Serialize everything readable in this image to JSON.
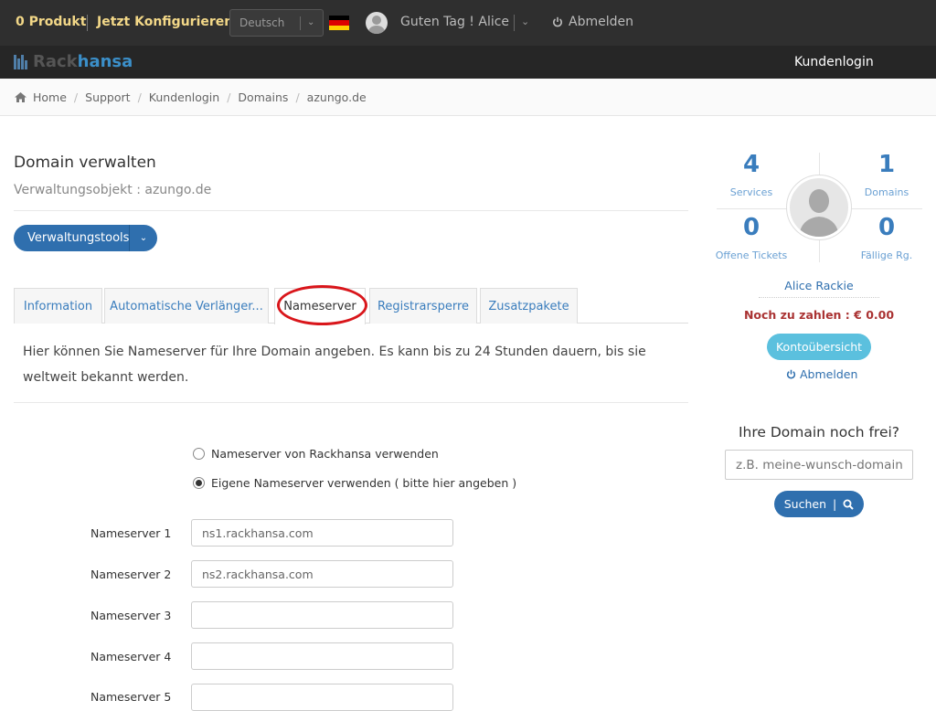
{
  "topbar": {
    "product_count": "0 Produkt",
    "configure": "Jetzt Konfigurieren",
    "language": "Deutsch",
    "greeting": "Guten Tag ! Alice",
    "logout": "Abmelden",
    "flag_colors": [
      "#000000",
      "#dd0000",
      "#ffce00"
    ]
  },
  "brand": {
    "part1": "Rack",
    "part2": "hansa",
    "accent": "#3b8fc9"
  },
  "nav": {
    "kundenlogin": "Kundenlogin"
  },
  "breadcrumb": [
    "Home",
    "Support",
    "Kundenlogin",
    "Domains",
    "azungo.de"
  ],
  "page": {
    "title": "Domain verwalten",
    "subtitle": "Verwaltungsobjekt : azungo.de",
    "tools_button": "Verwaltungstools"
  },
  "tabs": [
    {
      "label": "Information",
      "active": false
    },
    {
      "label": "Automatische Verlänger...",
      "active": false
    },
    {
      "label": "Nameserver",
      "active": true
    },
    {
      "label": "Registrarsperre",
      "active": false
    },
    {
      "label": "Zusatzpakete",
      "active": false
    }
  ],
  "nameserver": {
    "description": "Hier können Sie Nameserver für Ihre Domain angeben. Es kann bis zu 24 Stunden dauern, bis sie weltweit bekannt werden.",
    "option_default": "Nameserver von Rackhansa verwenden",
    "option_custom": "Eigene Nameserver verwenden ( bitte hier angeben )",
    "selected_option": "custom",
    "fields": [
      {
        "label": "Nameserver 1",
        "value": "ns1.rackhansa.com"
      },
      {
        "label": "Nameserver 2",
        "value": "ns2.rackhansa.com"
      },
      {
        "label": "Nameserver 3",
        "value": ""
      },
      {
        "label": "Nameserver 4",
        "value": ""
      },
      {
        "label": "Nameserver 5",
        "value": ""
      }
    ]
  },
  "sidebar": {
    "stats": {
      "services": {
        "value": "4",
        "label": "Services"
      },
      "domains": {
        "value": "1",
        "label": "Domains"
      },
      "tickets": {
        "value": "0",
        "label": "Offene Tickets"
      },
      "invoices": {
        "value": "0",
        "label": "Fällige Rg."
      }
    },
    "user_name": "Alice Rackie",
    "due": "Noch zu zahlen : € 0.00",
    "account_button": "Kontoübersicht",
    "logout": "Abmelden",
    "domain_search": {
      "title": "Ihre Domain noch frei?",
      "placeholder": "z.B. meine-wunsch-domain",
      "button": "Suchen"
    }
  },
  "colors": {
    "primary": "#2f6fae",
    "info": "#5bc0de",
    "highlight_circle": "#d9161b"
  }
}
